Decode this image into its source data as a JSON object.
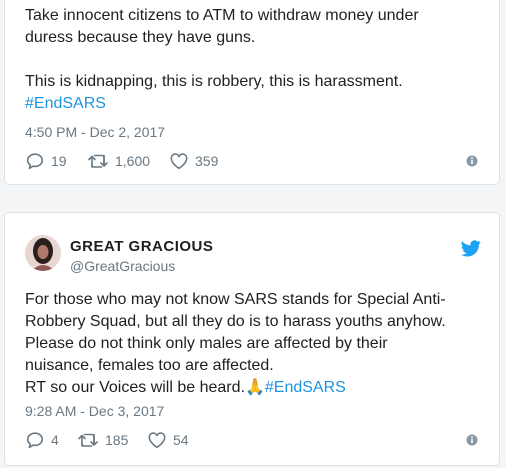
{
  "tweet1": {
    "lines": [
      "Take innocent citizens to ATM to withdraw money under",
      "duress because they have guns.",
      "",
      "This is kidnapping, this is robbery, this is harassment."
    ],
    "hashtag": "#EndSARS",
    "timestamp": "4:50 PM - Dec 2, 2017",
    "replies": "19",
    "retweets": "1,600",
    "likes": "359"
  },
  "tweet2": {
    "display_name": "GREAT GRACIOUS",
    "handle": "@GreatGracious",
    "lines": [
      "For those who may not know SARS stands for Special Anti-",
      "Robbery Squad, but all they do is to harass youths anyhow.",
      "Please do not think only males are affected by their",
      "nuisance, females too are affected."
    ],
    "last_line_prefix": "RT so our Voices will be heard.",
    "emoji": "🙏",
    "hashtag": "#EndSARS",
    "timestamp": "9:28 AM - Dec 3, 2017",
    "replies": "4",
    "retweets": "185",
    "likes": "54"
  },
  "icons": [
    "reply-icon",
    "retweet-icon",
    "heart-icon",
    "info-icon",
    "twitter-bird-icon",
    "avatar"
  ],
  "colors": {
    "link": "#1b95e0",
    "text": "#1c2022",
    "muted": "#697882",
    "border": "#dde3e8",
    "background": "#f4f5f6"
  }
}
